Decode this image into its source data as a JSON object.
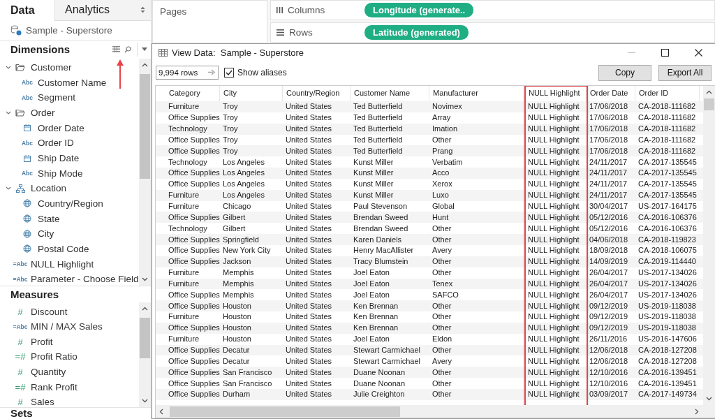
{
  "sidebar": {
    "tabs": [
      {
        "label": "Data",
        "selected": true
      },
      {
        "label": "Analytics",
        "selected": false
      }
    ],
    "datasource": "Sample - Superstore",
    "dimensions": {
      "title": "Dimensions",
      "items": [
        {
          "label": "Customer",
          "kind": "folder",
          "expanded": true,
          "children": [
            {
              "label": "Customer Name",
              "kind": "string",
              "type_label": "Abc"
            },
            {
              "label": "Segment",
              "kind": "string",
              "type_label": "Abc"
            }
          ]
        },
        {
          "label": "Order",
          "kind": "folder",
          "expanded": true,
          "children": [
            {
              "label": "Order Date",
              "kind": "date"
            },
            {
              "label": "Order ID",
              "kind": "string",
              "type_label": "Abc"
            },
            {
              "label": "Ship Date",
              "kind": "date"
            },
            {
              "label": "Ship Mode",
              "kind": "string",
              "type_label": "Abc"
            }
          ]
        },
        {
          "label": "Location",
          "kind": "hierarchy",
          "expanded": true,
          "children": [
            {
              "label": "Country/Region",
              "kind": "geo"
            },
            {
              "label": "State",
              "kind": "geo"
            },
            {
              "label": "City",
              "kind": "geo"
            },
            {
              "label": "Postal Code",
              "kind": "geo"
            }
          ]
        },
        {
          "label": "NULL Highlight",
          "kind": "calc_string",
          "type_label": "=Abc"
        },
        {
          "label": "Parameter - Choose Field",
          "kind": "calc_string",
          "type_label": "=Abc"
        }
      ]
    },
    "measures": {
      "title": "Measures",
      "items": [
        {
          "label": "Discount",
          "kind": "measure",
          "type_label": "#"
        },
        {
          "label": "MIN / MAX Sales",
          "kind": "calc_string",
          "type_label": "=Abc"
        },
        {
          "label": "Profit",
          "kind": "measure",
          "type_label": "#"
        },
        {
          "label": "Profit Ratio",
          "kind": "calc_measure",
          "type_label": "=#"
        },
        {
          "label": "Quantity",
          "kind": "measure",
          "type_label": "#"
        },
        {
          "label": "Rank Profit",
          "kind": "calc_measure",
          "type_label": "=#"
        },
        {
          "label": "Sales",
          "kind": "measure",
          "type_label": "#"
        }
      ]
    },
    "sets": {
      "title": "Sets"
    }
  },
  "shelves": {
    "pages": {
      "label": "Pages"
    },
    "columns": {
      "label": "Columns",
      "pills": [
        "Longitude (generate.."
      ]
    },
    "rows": {
      "label": "Rows",
      "pills": [
        "Latitude (generated)"
      ]
    }
  },
  "dialog": {
    "title": "View Data:  Sample - Superstore",
    "rows_field": "9,994 rows",
    "show_aliases": {
      "label": "Show aliases",
      "checked": true
    },
    "buttons": [
      "Copy",
      "Export All"
    ],
    "table": {
      "columns": [
        {
          "label": "Category",
          "highlighted": false
        },
        {
          "label": "City",
          "highlighted": false
        },
        {
          "label": "Country/Region",
          "highlighted": false
        },
        {
          "label": "Customer Name",
          "highlighted": false
        },
        {
          "label": "Manufacturer",
          "highlighted": false
        },
        {
          "label": "NULL Highlight",
          "highlighted": true
        },
        {
          "label": "Order Date",
          "highlighted": false
        },
        {
          "label": "Order ID",
          "highlighted": false
        }
      ],
      "rows": [
        [
          "Furniture",
          "Troy",
          "United States",
          "Ted Butterfield",
          "Novimex",
          "NULL Highlight",
          "17/06/2018",
          "CA-2018-111682"
        ],
        [
          "Office Supplies",
          "Troy",
          "United States",
          "Ted Butterfield",
          "Array",
          "NULL Highlight",
          "17/06/2018",
          "CA-2018-111682"
        ],
        [
          "Technology",
          "Troy",
          "United States",
          "Ted Butterfield",
          "Imation",
          "NULL Highlight",
          "17/06/2018",
          "CA-2018-111682"
        ],
        [
          "Office Supplies",
          "Troy",
          "United States",
          "Ted Butterfield",
          "Other",
          "NULL Highlight",
          "17/06/2018",
          "CA-2018-111682"
        ],
        [
          "Office Supplies",
          "Troy",
          "United States",
          "Ted Butterfield",
          "Prang",
          "NULL Highlight",
          "17/06/2018",
          "CA-2018-111682"
        ],
        [
          "Technology",
          "Los Angeles",
          "United States",
          "Kunst Miller",
          "Verbatim",
          "NULL Highlight",
          "24/11/2017",
          "CA-2017-135545"
        ],
        [
          "Office Supplies",
          "Los Angeles",
          "United States",
          "Kunst Miller",
          "Acco",
          "NULL Highlight",
          "24/11/2017",
          "CA-2017-135545"
        ],
        [
          "Office Supplies",
          "Los Angeles",
          "United States",
          "Kunst Miller",
          "Xerox",
          "NULL Highlight",
          "24/11/2017",
          "CA-2017-135545"
        ],
        [
          "Furniture",
          "Los Angeles",
          "United States",
          "Kunst Miller",
          "Luxo",
          "NULL Highlight",
          "24/11/2017",
          "CA-2017-135545"
        ],
        [
          "Furniture",
          "Chicago",
          "United States",
          "Paul Stevenson",
          "Global",
          "NULL Highlight",
          "30/04/2017",
          "US-2017-164175"
        ],
        [
          "Office Supplies",
          "Gilbert",
          "United States",
          "Brendan Sweed",
          "Hunt",
          "NULL Highlight",
          "05/12/2016",
          "CA-2016-106376"
        ],
        [
          "Technology",
          "Gilbert",
          "United States",
          "Brendan Sweed",
          "Other",
          "NULL Highlight",
          "05/12/2016",
          "CA-2016-106376"
        ],
        [
          "Office Supplies",
          "Springfield",
          "United States",
          "Karen Daniels",
          "Other",
          "NULL Highlight",
          "04/06/2018",
          "CA-2018-119823"
        ],
        [
          "Office Supplies",
          "New York City",
          "United States",
          "Henry MacAllister",
          "Avery",
          "NULL Highlight",
          "18/09/2018",
          "CA-2018-106075"
        ],
        [
          "Office Supplies",
          "Jackson",
          "United States",
          "Tracy Blumstein",
          "Other",
          "NULL Highlight",
          "14/09/2019",
          "CA-2019-114440"
        ],
        [
          "Furniture",
          "Memphis",
          "United States",
          "Joel Eaton",
          "Other",
          "NULL Highlight",
          "26/04/2017",
          "US-2017-134026"
        ],
        [
          "Furniture",
          "Memphis",
          "United States",
          "Joel Eaton",
          "Tenex",
          "NULL Highlight",
          "26/04/2017",
          "US-2017-134026"
        ],
        [
          "Office Supplies",
          "Memphis",
          "United States",
          "Joel Eaton",
          "SAFCO",
          "NULL Highlight",
          "26/04/2017",
          "US-2017-134026"
        ],
        [
          "Office Supplies",
          "Houston",
          "United States",
          "Ken Brennan",
          "Other",
          "NULL Highlight",
          "09/12/2019",
          "US-2019-118038"
        ],
        [
          "Furniture",
          "Houston",
          "United States",
          "Ken Brennan",
          "Other",
          "NULL Highlight",
          "09/12/2019",
          "US-2019-118038"
        ],
        [
          "Office Supplies",
          "Houston",
          "United States",
          "Ken Brennan",
          "Other",
          "NULL Highlight",
          "09/12/2019",
          "US-2019-118038"
        ],
        [
          "Furniture",
          "Houston",
          "United States",
          "Joel Eaton",
          "Eldon",
          "NULL Highlight",
          "26/11/2016",
          "US-2016-147606"
        ],
        [
          "Office Supplies",
          "Decatur",
          "United States",
          "Stewart Carmichael",
          "Other",
          "NULL Highlight",
          "12/06/2018",
          "CA-2018-127208"
        ],
        [
          "Office Supplies",
          "Decatur",
          "United States",
          "Stewart Carmichael",
          "Avery",
          "NULL Highlight",
          "12/06/2018",
          "CA-2018-127208"
        ],
        [
          "Office Supplies",
          "San Francisco",
          "United States",
          "Duane Noonan",
          "Other",
          "NULL Highlight",
          "12/10/2016",
          "CA-2016-139451"
        ],
        [
          "Office Supplies",
          "San Francisco",
          "United States",
          "Duane Noonan",
          "Other",
          "NULL Highlight",
          "12/10/2016",
          "CA-2016-139451"
        ],
        [
          "Office Supplies",
          "Durham",
          "United States",
          "Julie Creighton",
          "Other",
          "NULL Highlight",
          "03/09/2017",
          "CA-2017-149734"
        ]
      ]
    }
  }
}
